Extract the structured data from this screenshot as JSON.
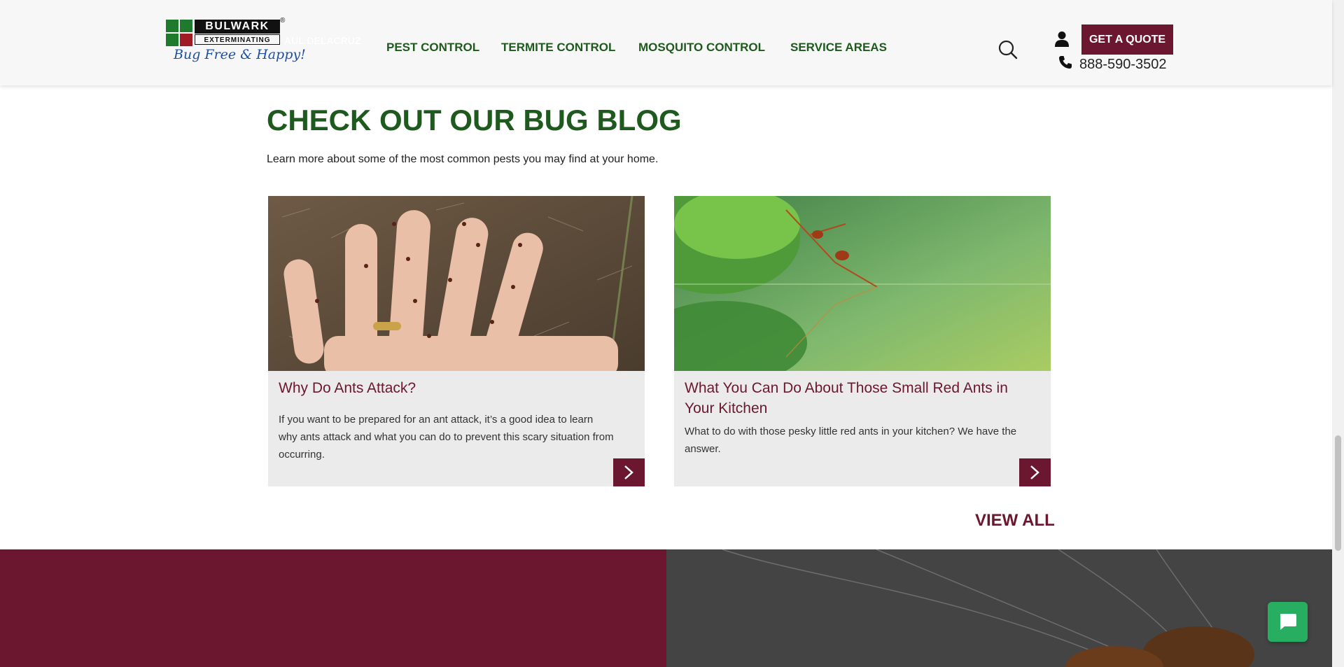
{
  "header": {
    "logo": {
      "word": "BULWARK",
      "sub": "EXTERMINATING",
      "tagline": "Bug Free & Happy!",
      "reg": "®"
    },
    "ghost_text": "AUL DELACRUZ",
    "nav": [
      {
        "label": "PEST CONTROL"
      },
      {
        "label": "TERMITE CONTROL"
      },
      {
        "label": "MOSQUITO CONTROL"
      },
      {
        "label": "SERVICE AREAS"
      }
    ],
    "quote_label": "GET A QUOTE",
    "phone": "888-590-3502",
    "icons": [
      "search-icon",
      "user-icon",
      "phone-icon"
    ]
  },
  "blog": {
    "title": "CHECK OUT OUR BUG BLOG",
    "subtitle": "Learn more about some of the most common pests you may find at your home.",
    "cards": [
      {
        "title": "Why Do Ants Attack?",
        "text": "If you want to be prepared for an ant attack, it’s a good idea to learn why ants attack and what you can do to prevent this scary situation from occurring."
      },
      {
        "title": "What You Can Do About Those Small Red Ants in Your Kitchen",
        "text": "What to do with those pesky little red ants in your kitchen? We have the answer."
      }
    ],
    "view_all": "VIEW ALL"
  },
  "colors": {
    "brand_green": "#1e5a1e",
    "brand_maroon": "#6b1730",
    "chat_green": "#27ae60",
    "card_bg": "#ebebeb"
  }
}
